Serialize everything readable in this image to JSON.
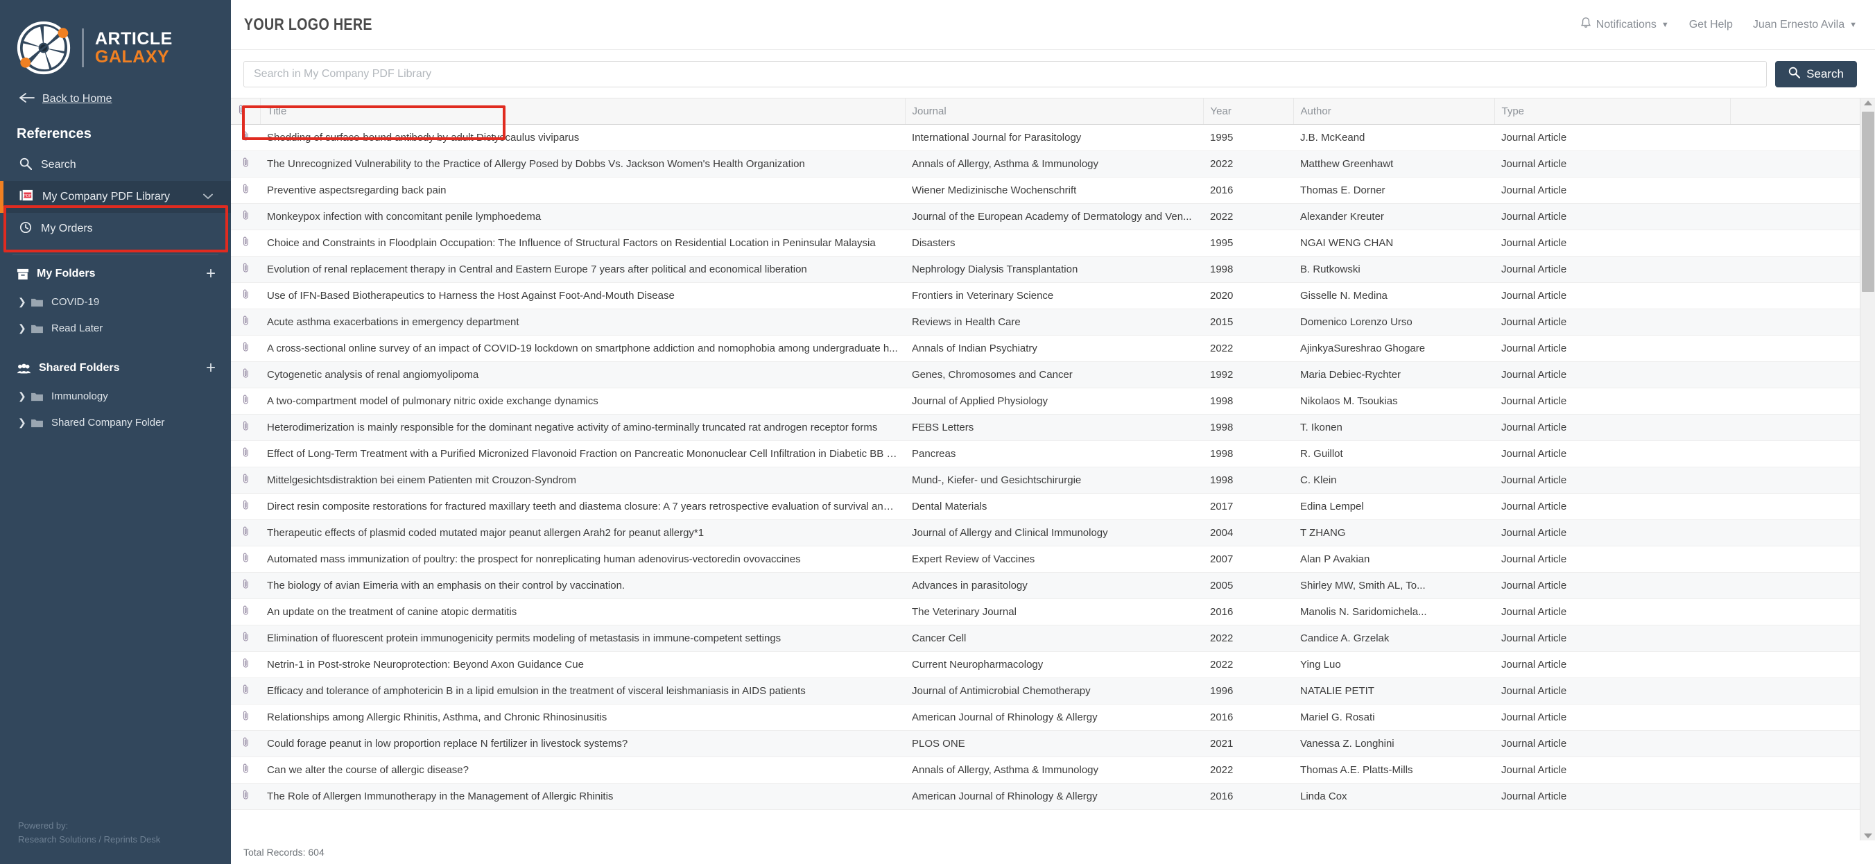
{
  "sidebar": {
    "logo": {
      "line1": "ARTICLE",
      "line2": "GALAXY",
      "icon": "article-galaxy-logo"
    },
    "back_home": {
      "label": "Back to Home",
      "icon": "arrow-left-icon"
    },
    "section_title": "References",
    "nav": [
      {
        "label": "Search",
        "icon": "search-icon",
        "active": false
      },
      {
        "label": "My Company PDF Library",
        "icon": "pdf-library-icon",
        "active": true,
        "chevron": "chevron-down-icon"
      },
      {
        "label": "My Orders",
        "icon": "history-clock-icon",
        "active": false
      }
    ],
    "my_folders": {
      "label": "My Folders",
      "icon": "archive-box-icon",
      "add_label": "+",
      "items": [
        {
          "label": "COVID-19",
          "icon": "folder-icon",
          "caret": "chevron-right-icon"
        },
        {
          "label": "Read Later",
          "icon": "folder-icon",
          "caret": "chevron-right-icon"
        }
      ]
    },
    "shared_folders": {
      "label": "Shared Folders",
      "icon": "people-icon",
      "add_label": "+",
      "items": [
        {
          "label": "Immunology",
          "icon": "folder-icon",
          "caret": "chevron-right-icon"
        },
        {
          "label": "Shared Company Folder",
          "icon": "folder-icon",
          "caret": "chevron-right-icon"
        }
      ]
    },
    "powered_by": {
      "line1": "Powered by:",
      "line2": "Research Solutions / Reprints Desk"
    }
  },
  "topbar": {
    "logo_placeholder": "YOUR LOGO HERE",
    "notifications": {
      "label": "Notifications",
      "icon": "bell-icon",
      "caret": "caret-down-icon"
    },
    "get_help": "Get Help",
    "user": {
      "name": "Juan Ernesto Avila",
      "caret": "caret-down-icon"
    }
  },
  "search": {
    "placeholder": "Search in My Company PDF Library",
    "value": "",
    "button_label": "Search",
    "button_icon": "search-icon"
  },
  "table": {
    "columns": [
      "",
      "Title",
      "Journal",
      "Year",
      "Author",
      "Type",
      ""
    ],
    "attachment_icon": "paperclip-icon",
    "rows": [
      {
        "title": "Shedding of surface-bound antibody by adult Dictyocaulus viviparus",
        "journal": "International Journal for Parasitology",
        "year": "1995",
        "author": "J.B. McKeand",
        "type": "Journal Article"
      },
      {
        "title": "The Unrecognized Vulnerability to the Practice of Allergy Posed by Dobbs Vs. Jackson Women's Health Organization",
        "journal": "Annals of Allergy, Asthma & Immunology",
        "year": "2022",
        "author": "Matthew Greenhawt",
        "type": "Journal Article"
      },
      {
        "title": "Preventive aspectsregarding back pain",
        "journal": "Wiener Medizinische Wochenschrift",
        "year": "2016",
        "author": "Thomas E. Dorner",
        "type": "Journal Article"
      },
      {
        "title": "Monkeypox infection with concomitant penile lymphoedema",
        "journal": "Journal of the European Academy of Dermatology and Ven...",
        "year": "2022",
        "author": "Alexander Kreuter",
        "type": "Journal Article"
      },
      {
        "title": "Choice and Constraints in Floodplain Occupation: The Influence of Structural Factors on Residential Location in Peninsular Malaysia",
        "journal": "Disasters",
        "year": "1995",
        "author": "NGAI WENG CHAN",
        "type": "Journal Article"
      },
      {
        "title": "Evolution of renal replacement therapy in Central and Eastern Europe 7 years after political and economical liberation",
        "journal": "Nephrology Dialysis Transplantation",
        "year": "1998",
        "author": "B. Rutkowski",
        "type": "Journal Article"
      },
      {
        "title": "Use of IFN-Based Biotherapeutics to Harness the Host Against Foot-And-Mouth Disease",
        "journal": "Frontiers in Veterinary Science",
        "year": "2020",
        "author": "Gisselle N. Medina",
        "type": "Journal Article"
      },
      {
        "title": "Acute asthma exacerbations in emergency department",
        "journal": "Reviews in Health Care",
        "year": "2015",
        "author": "Domenico Lorenzo Urso",
        "type": "Journal Article"
      },
      {
        "title": "A cross-sectional online survey of an impact of COVID-19 lockdown on smartphone addiction and nomophobia among undergraduate h...",
        "journal": "Annals of Indian Psychiatry",
        "year": "2022",
        "author": "AjinkyaSureshrao Ghogare",
        "type": "Journal Article"
      },
      {
        "title": "Cytogenetic analysis of renal angiomyolipoma",
        "journal": "Genes, Chromosomes and Cancer",
        "year": "1992",
        "author": "Maria Debiec-Rychter",
        "type": "Journal Article"
      },
      {
        "title": "A two-compartment model of pulmonary nitric oxide exchange dynamics",
        "journal": "Journal of Applied Physiology",
        "year": "1998",
        "author": "Nikolaos M. Tsoukias",
        "type": "Journal Article"
      },
      {
        "title": "Heterodimerization is mainly responsible for the dominant negative activity of amino-terminally truncated rat androgen receptor forms",
        "journal": "FEBS Letters",
        "year": "1998",
        "author": "T. Ikonen",
        "type": "Journal Article"
      },
      {
        "title": "Effect of Long-Term Treatment with a Purified Micronized Flavonoid Fraction on Pancreatic Mononuclear Cell Infiltration in Diabetic BB R...",
        "journal": "Pancreas",
        "year": "1998",
        "author": "R. Guillot",
        "type": "Journal Article"
      },
      {
        "title": "Mittelgesichtsdistraktion bei einem Patienten mit Crouzon-Syndrom",
        "journal": "Mund-, Kiefer- und Gesichtschirurgie",
        "year": "1998",
        "author": "C. Klein",
        "type": "Journal Article"
      },
      {
        "title": "Direct resin composite restorations for fractured maxillary teeth and diastema closure: A 7 years retrospective evaluation of survival and i...",
        "journal": "Dental Materials",
        "year": "2017",
        "author": "Edina Lempel",
        "type": "Journal Article"
      },
      {
        "title": "Therapeutic effects of plasmid coded mutated major peanut allergen Arah2 for peanut allergy*1",
        "journal": "Journal of Allergy and Clinical Immunology",
        "year": "2004",
        "author": "T ZHANG",
        "type": "Journal Article"
      },
      {
        "title": "Automated mass immunization of poultry: the prospect for nonreplicating human adenovirus-vectoredin ovovaccines",
        "journal": "Expert Review of Vaccines",
        "year": "2007",
        "author": "Alan P Avakian",
        "type": "Journal Article"
      },
      {
        "title": "The biology of avian Eimeria with an emphasis on their control by vaccination.",
        "journal": "Advances in parasitology",
        "year": "2005",
        "author": "Shirley MW, Smith AL, To...",
        "type": "Journal Article"
      },
      {
        "title": "An update on the treatment of canine atopic dermatitis",
        "journal": "The Veterinary Journal",
        "year": "2016",
        "author": "Manolis N. Saridomichela...",
        "type": "Journal Article"
      },
      {
        "title": "Elimination of fluorescent protein immunogenicity permits modeling of metastasis in immune-competent settings",
        "journal": "Cancer Cell",
        "year": "2022",
        "author": "Candice A. Grzelak",
        "type": "Journal Article"
      },
      {
        "title": "Netrin-1 in Post-stroke Neuroprotection: Beyond Axon Guidance Cue",
        "journal": "Current Neuropharmacology",
        "year": "2022",
        "author": "Ying Luo",
        "type": "Journal Article"
      },
      {
        "title": "Efficacy and tolerance of amphotericin B in a lipid emulsion in the treatment of visceral leishmaniasis in AIDS patients",
        "journal": "Journal of Antimicrobial Chemotherapy",
        "year": "1996",
        "author": "NATALIE PETIT",
        "type": "Journal Article"
      },
      {
        "title": "Relationships among Allergic Rhinitis, Asthma, and Chronic Rhinosinusitis",
        "journal": "American Journal of Rhinology & Allergy",
        "year": "2016",
        "author": "Mariel G. Rosati",
        "type": "Journal Article"
      },
      {
        "title": "Could forage peanut in low proportion replace N fertilizer in livestock systems?",
        "journal": "PLOS ONE",
        "year": "2021",
        "author": "Vanessa Z. Longhini",
        "type": "Journal Article"
      },
      {
        "title": "Can we alter the course of allergic disease?",
        "journal": "Annals of Allergy, Asthma & Immunology",
        "year": "2022",
        "author": "Thomas A.E. Platts-Mills",
        "type": "Journal Article"
      },
      {
        "title": "The Role of Allergen Immunotherapy in the Management of Allergic Rhinitis",
        "journal": "American Journal of Rhinology & Allergy",
        "year": "2016",
        "author": "Linda Cox",
        "type": "Journal Article"
      }
    ]
  },
  "footer": {
    "total_records": "Total Records: 604"
  },
  "colors": {
    "sidebar_bg": "#32475c",
    "accent_orange": "#f08022",
    "highlight_red": "#e02b20",
    "button_dark": "#32475c"
  }
}
